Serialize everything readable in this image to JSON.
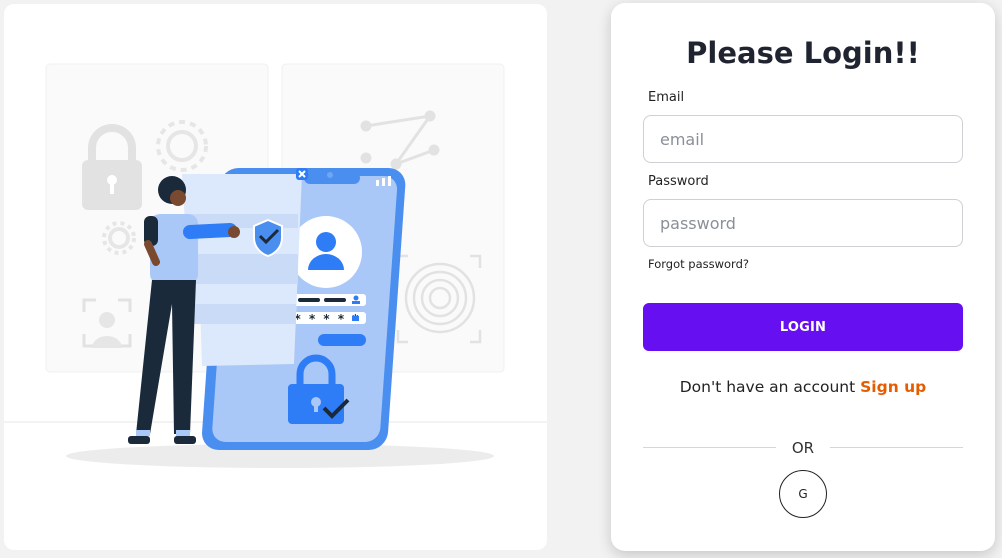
{
  "login": {
    "title": "Please Login!!",
    "email_label": "Email",
    "email_placeholder": "email",
    "password_label": "Password",
    "password_placeholder": "password",
    "forgot_password": "Forgot password?",
    "login_button": "LOGIN",
    "no_account_text": "Don't have an account",
    "signup_link": "Sign up",
    "or_text": "OR",
    "google_button": "G"
  },
  "illustration": {
    "icon": "secure-login-illustration",
    "password_mask": "* * * * *",
    "colors": {
      "phone_blue": "#4a8ef0",
      "screen_light_blue": "#a9c8f7",
      "panel_pale_blue": "#dce8fb"
    }
  },
  "colors": {
    "accent_purple": "#6610f2",
    "signup_orange": "#e65c00"
  }
}
